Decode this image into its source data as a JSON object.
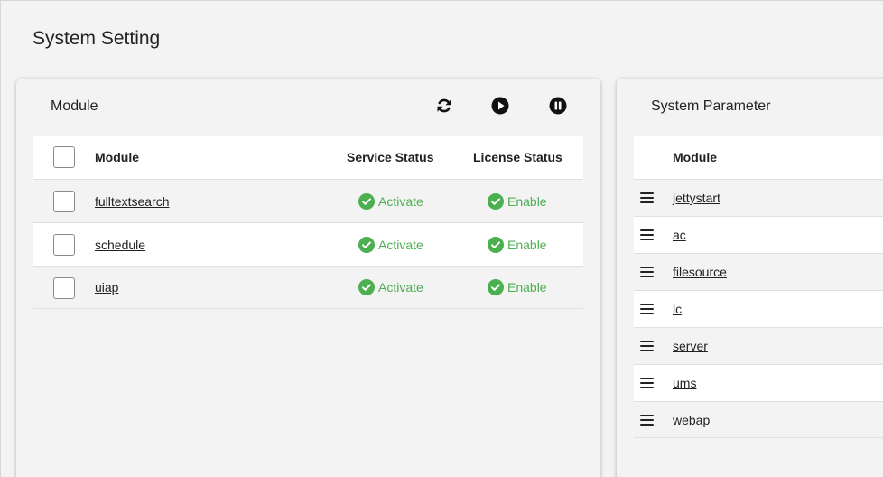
{
  "page": {
    "title": "System Setting"
  },
  "module_panel": {
    "title": "Module",
    "toolbar": [
      {
        "name": "refresh-button",
        "icon": "refresh-icon"
      },
      {
        "name": "start-button",
        "icon": "play-circle-icon"
      },
      {
        "name": "stop-button",
        "icon": "pause-circle-icon"
      }
    ],
    "columns": {
      "module": "Module",
      "service_status": "Service Status",
      "license_status": "License Status"
    },
    "rows": [
      {
        "module": "fulltextsearch",
        "service_status": "Activate",
        "license_status": "Enable"
      },
      {
        "module": "schedule",
        "service_status": "Activate",
        "license_status": "Enable"
      },
      {
        "module": "uiap",
        "service_status": "Activate",
        "license_status": "Enable"
      }
    ]
  },
  "param_panel": {
    "title": "System Parameter",
    "columns": {
      "module": "Module"
    },
    "rows": [
      {
        "module": "jettystart"
      },
      {
        "module": "ac"
      },
      {
        "module": "filesource"
      },
      {
        "module": "lc"
      },
      {
        "module": "server"
      },
      {
        "module": "ums"
      },
      {
        "module": "webap"
      }
    ]
  },
  "colors": {
    "status_green": "#4caf50",
    "text": "#222222",
    "row_alt": "#f3f3f3"
  }
}
